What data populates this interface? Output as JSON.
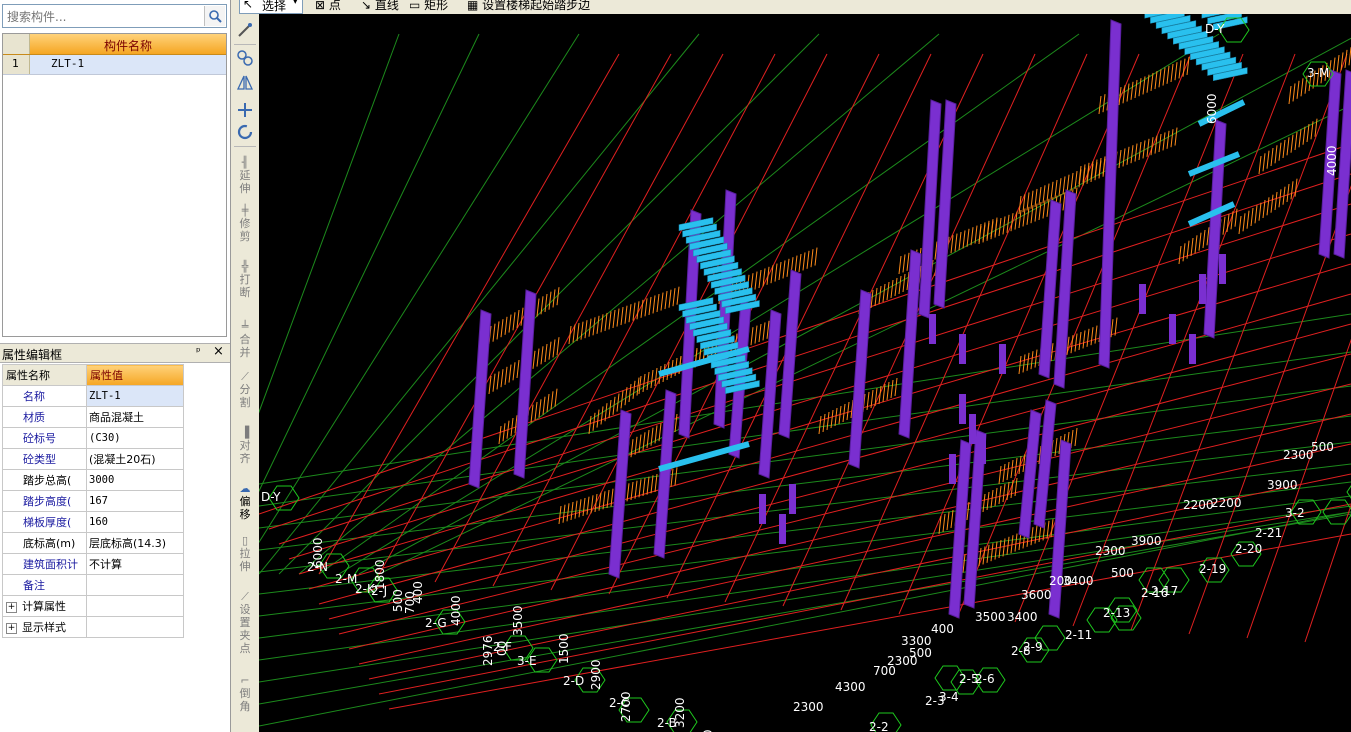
{
  "search": {
    "placeholder": "搜索构件..."
  },
  "component_list": {
    "header": "构件名称",
    "rows": [
      {
        "index": "1",
        "name": "ZLT-1"
      }
    ]
  },
  "property_panel": {
    "title": "属性编辑框",
    "pin": "ᵖ",
    "close": "×",
    "col_name": "属性名称",
    "col_value": "属性值",
    "rows": [
      {
        "name": "名称",
        "value": "ZLT-1"
      },
      {
        "name": "材质",
        "value": "商品混凝土"
      },
      {
        "name": "砼标号",
        "value": "(C30)"
      },
      {
        "name": "砼类型",
        "value": "(混凝土20石)"
      },
      {
        "name": "踏步总高(",
        "value": "3000"
      },
      {
        "name": "踏步高度(",
        "value": "167"
      },
      {
        "name": "梯板厚度(",
        "value": "160"
      },
      {
        "name": "底标高(m)",
        "value": "层底标高(14.3)"
      },
      {
        "name": "建筑面积计",
        "value": "不计算"
      },
      {
        "name": "备注",
        "value": ""
      }
    ],
    "groups": [
      "计算属性",
      "显示样式"
    ]
  },
  "top_toolbar": {
    "select": "选择",
    "point": "点",
    "line": "直线",
    "rect": "矩形",
    "stair_edge": "设置楼梯起始踏步边"
  },
  "side_toolbar": {
    "extend": "延伸",
    "trim": "修剪",
    "break": "打断",
    "merge": "合并",
    "split": "分割",
    "align": "对齐",
    "offset": "偏移",
    "stretch": "拉伸",
    "grip": "设置夹点",
    "chamfer": "倒角"
  },
  "viewport_labels": {
    "axes": [
      "D-Y",
      "D-Y",
      "2-N",
      "2-M",
      "2-K",
      "2-J",
      "2-G",
      "2-F",
      "3-E",
      "2-D",
      "2-C",
      "2-B",
      "2-2",
      "2-3",
      "3-4",
      "2-5",
      "2-6",
      "2-8",
      "2-9",
      "2-11",
      "2-13",
      "2-16",
      "2-17",
      "2-19",
      "2-20",
      "2-21",
      "3-2",
      "3-M"
    ],
    "dims": [
      "6000",
      "1800",
      "500",
      "700",
      "400",
      "4000",
      "2976",
      "00",
      "3500",
      "1500",
      "2900",
      "2700",
      "3200",
      "1900",
      "2300",
      "4300",
      "700",
      "2300",
      "500",
      "3300",
      "400",
      "3500",
      "3400",
      "3600",
      "200",
      "3400",
      "500",
      "2300",
      "3900",
      "2200",
      "2200",
      "3900",
      "2300",
      "500",
      "6000",
      "4000"
    ]
  }
}
